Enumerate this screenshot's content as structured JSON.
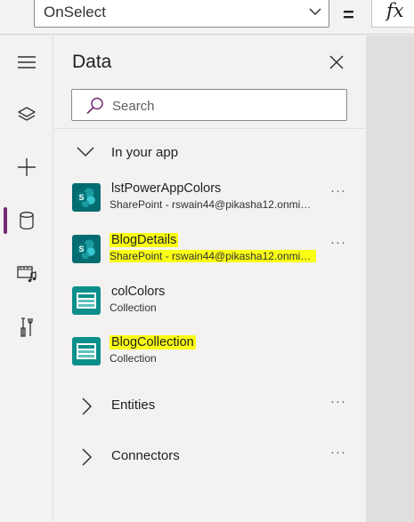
{
  "formula_bar": {
    "property": "OnSelect",
    "equals": "=",
    "fx_label": "fx"
  },
  "rail": [
    {
      "icon": "hamburger-menu-icon",
      "active": false
    },
    {
      "icon": "layers-icon",
      "active": false
    },
    {
      "icon": "plus-icon",
      "active": false
    },
    {
      "icon": "database-icon",
      "active": true
    },
    {
      "icon": "media-icon",
      "active": false
    },
    {
      "icon": "tools-icon",
      "active": false
    }
  ],
  "panel": {
    "title": "Data",
    "search_placeholder": "Search",
    "in_app_label": "In your app",
    "sources": [
      {
        "name": "lstPowerAppColors",
        "sub": "SharePoint - rswain44@pikasha12.onmicrosoft.com",
        "icon": "sharepoint-icon",
        "highlighted": false
      },
      {
        "name": "BlogDetails",
        "sub": "SharePoint - rswain44@pikasha12.onmicrosoft.com",
        "icon": "sharepoint-icon",
        "highlighted": true
      },
      {
        "name": "colColors",
        "sub": "Collection",
        "icon": "collection-icon",
        "highlighted": false
      },
      {
        "name": "BlogCollection",
        "sub": "Collection",
        "icon": "collection-icon",
        "highlighted": true
      }
    ],
    "entities_label": "Entities",
    "connectors_label": "Connectors",
    "more_label": "···"
  },
  "colors": {
    "accent": "#742774",
    "sharepoint": "#036c70",
    "highlight": "#fafe14"
  }
}
